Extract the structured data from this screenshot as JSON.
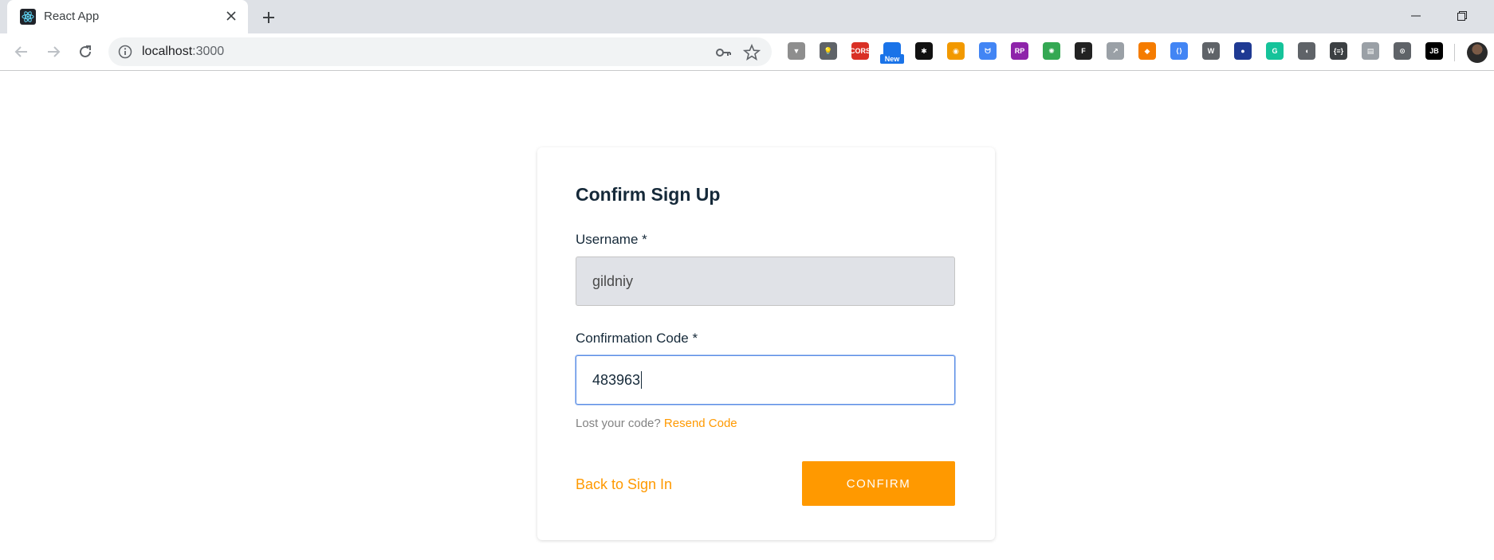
{
  "browser": {
    "tab_title": "React App",
    "url_host": "localhost",
    "url_port": ":3000",
    "extensions": [
      {
        "name": "vue-devtools-icon",
        "color": "#8e8e8e",
        "text": "▼"
      },
      {
        "name": "lightbulb-icon",
        "color": "#5f6368",
        "text": "💡"
      },
      {
        "name": "cors-icon",
        "color": "#d93025",
        "text": "CORS"
      },
      {
        "name": "screenshot-icon",
        "color": "#1a73e8",
        "text": "",
        "badge": "New"
      },
      {
        "name": "color-picker-icon",
        "color": "#111111",
        "text": "✱"
      },
      {
        "name": "eye-icon",
        "color": "#f29900",
        "text": "◉"
      },
      {
        "name": "ufo-icon",
        "color": "#4285f4",
        "text": "ᗢ"
      },
      {
        "name": "rp-icon",
        "color": "#8e24aa",
        "text": "RP"
      },
      {
        "name": "color-wheel-icon",
        "color": "#34a853",
        "text": "✺"
      },
      {
        "name": "figma-icon",
        "color": "#222222",
        "text": "F"
      },
      {
        "name": "chart-icon",
        "color": "#9aa0a6",
        "text": "↗"
      },
      {
        "name": "fox-icon",
        "color": "#f57c00",
        "text": "◆"
      },
      {
        "name": "code-window-icon",
        "color": "#4285f4",
        "text": "⟨⟩"
      },
      {
        "name": "wordpress-icon",
        "color": "#5f6368",
        "text": "W"
      },
      {
        "name": "night-icon",
        "color": "#1f3a93",
        "text": "●"
      },
      {
        "name": "grammarly-icon",
        "color": "#15c39a",
        "text": "G"
      },
      {
        "name": "audio-icon",
        "color": "#5f6368",
        "text": "◖"
      },
      {
        "name": "json-icon",
        "color": "#3c4043",
        "text": "{≡}"
      },
      {
        "name": "document-icon",
        "color": "#9aa0a6",
        "text": "▤"
      },
      {
        "name": "devtools-icon",
        "color": "#5f6368",
        "text": "⊙"
      },
      {
        "name": "jetbrains-icon",
        "color": "#000000",
        "text": "JB"
      }
    ]
  },
  "form": {
    "title": "Confirm Sign Up",
    "username_label": "Username *",
    "username_value": "gildniy",
    "code_label": "Confirmation Code *",
    "code_value": "483963",
    "hint_text": "Lost your code?",
    "resend_link": "Resend Code",
    "back_link": "Back to Sign In",
    "confirm_button": "CONFIRM"
  },
  "colors": {
    "accent": "#ff9900",
    "focus_border": "#5c8ee6",
    "text": "#152939"
  }
}
